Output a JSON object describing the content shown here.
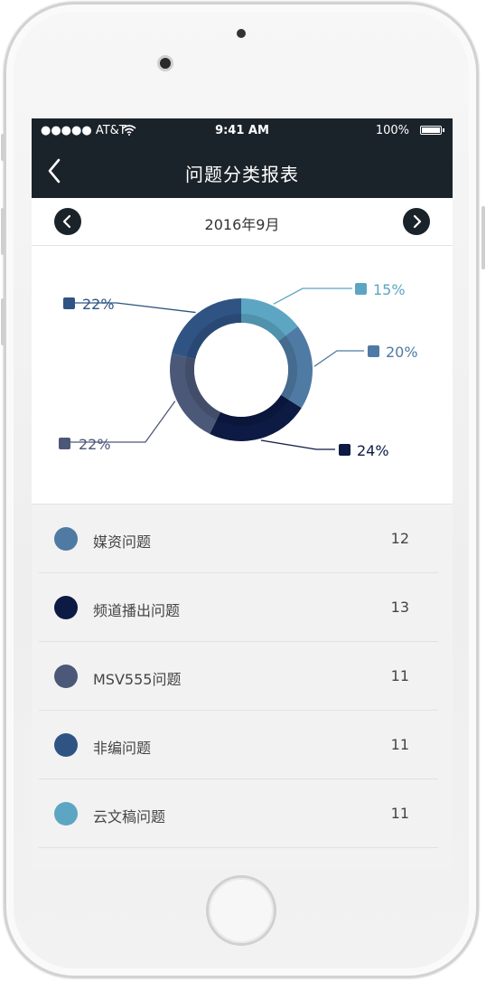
{
  "status_bar": {
    "carrier": "●●●●● AT&T",
    "time": "9:41 AM",
    "battery": "100%"
  },
  "navbar": {
    "title": "问题分类报表"
  },
  "date_bar": {
    "date": "2016年9月"
  },
  "chart_data": {
    "type": "pie",
    "categories": [
      "媒资问题",
      "频道播出问题",
      "MSV555问题",
      "非编问题",
      "云文稿问题"
    ],
    "values": [
      20,
      24,
      22,
      22,
      15
    ],
    "data_labels": [
      "20%",
      "24%",
      "22%",
      "22%",
      "15%"
    ],
    "colors": [
      "#4f7aa3",
      "#0c1a44",
      "#4c5878",
      "#2f5484",
      "#5ca6c3"
    ]
  },
  "list": [
    {
      "label": "媒资问题",
      "count": "12",
      "color": "#4f7aa3"
    },
    {
      "label": "频道播出问题",
      "count": "13",
      "color": "#0c1a44"
    },
    {
      "label": "MSV555问题",
      "count": "11",
      "color": "#4c5878"
    },
    {
      "label": "非编问题",
      "count": "11",
      "color": "#2f5484"
    },
    {
      "label": "云文稿问题",
      "count": "11",
      "color": "#5ca6c3"
    }
  ]
}
